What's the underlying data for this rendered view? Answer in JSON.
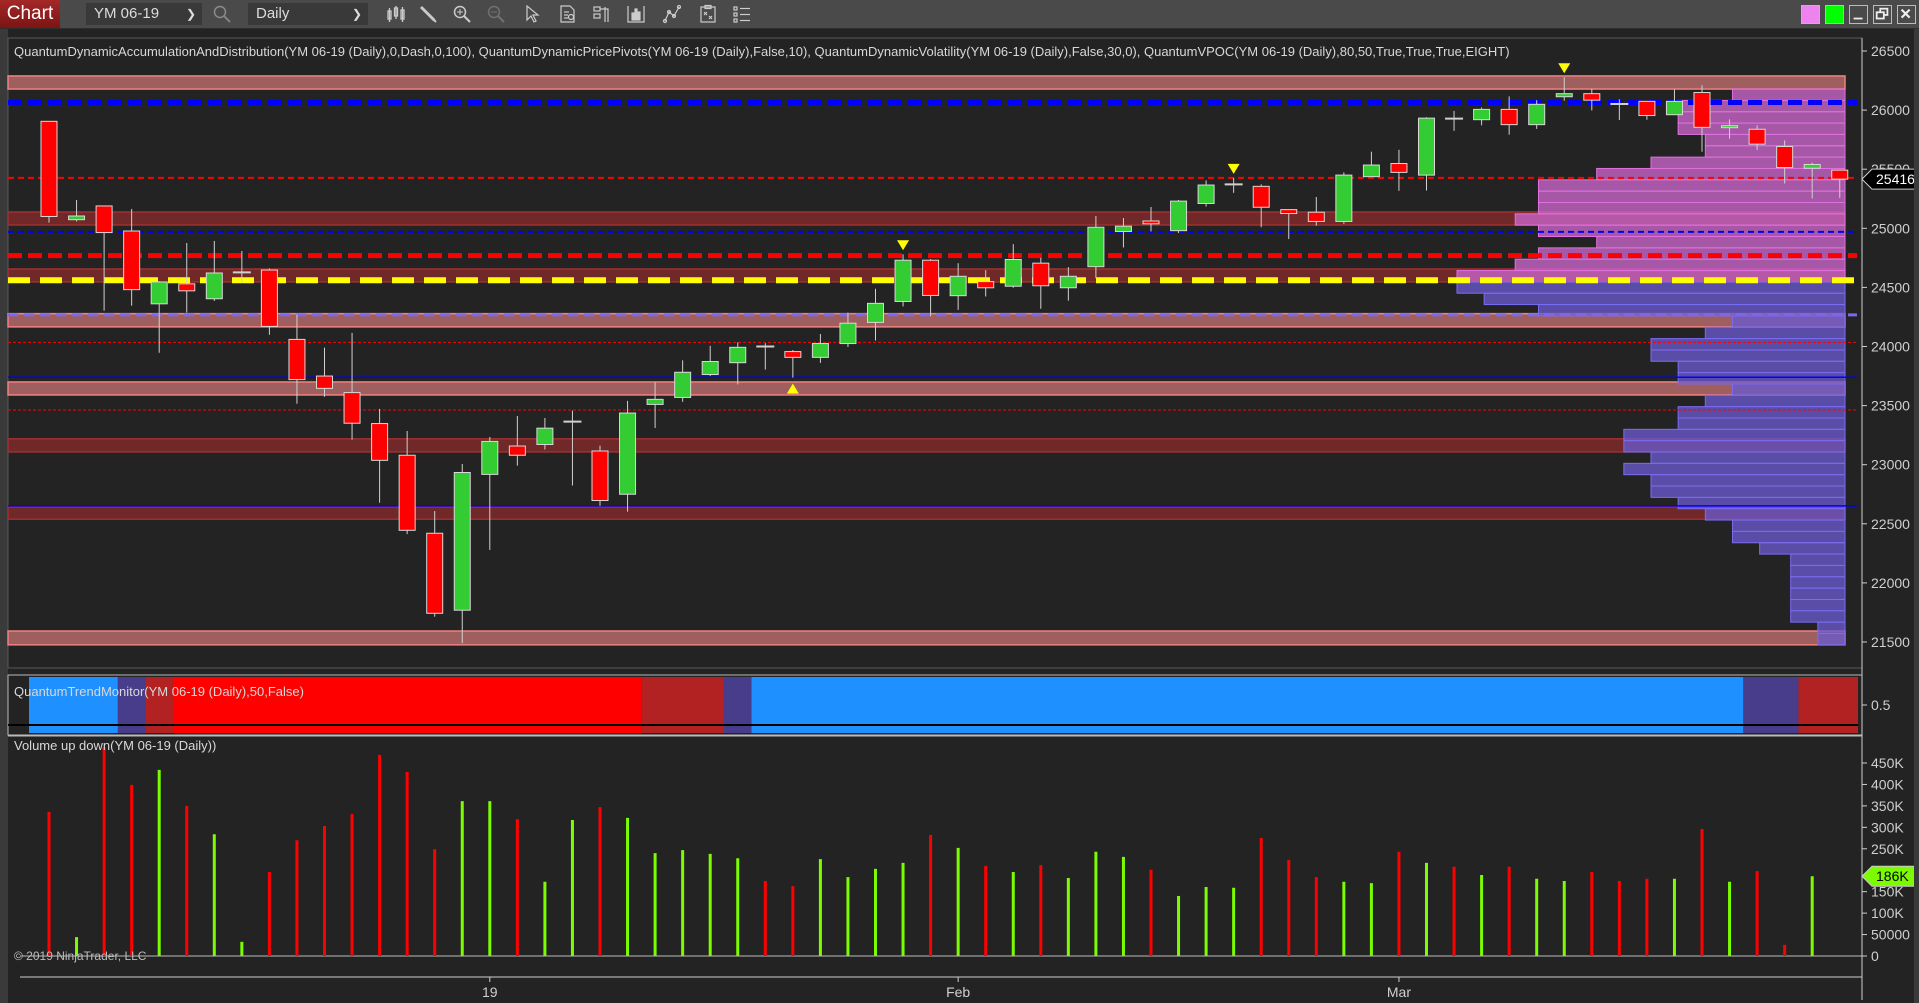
{
  "toolbar": {
    "tab_label": "Chart",
    "instrument": "YM 06-19",
    "timeframe": "Daily",
    "icons": [
      "search-icon",
      "bar-type-icon",
      "drawing-pencil-icon",
      "zoom-in-icon",
      "zoom-out-icon",
      "pointer-icon",
      "data-box-icon",
      "chart-trader-icon",
      "indicators-icon",
      "strategies-icon",
      "templates-icon",
      "properties-list-icon"
    ],
    "window_buttons": [
      "pink-color-swatch",
      "green-color-swatch",
      "minimize-button",
      "restore-button",
      "close-button"
    ],
    "colors": {
      "swatch_pink": "#ee82ee",
      "swatch_green": "#00ff00"
    }
  },
  "price_panel": {
    "indicators_label": "QuantumDynamicAccumulationAndDistribution(YM 06-19 (Daily),0,Dash,0,100), QuantumDynamicPricePivots(YM 06-19 (Daily),False,10), QuantumDynamicVolatility(YM 06-19 (Daily),False,30,0), QuantumVPOC(YM 06-19 (Daily),80,50,True,True,True,EIGHT)",
    "axis_ticks": [
      "26500",
      "26000",
      "25500",
      "25000",
      "24500",
      "24000",
      "23500",
      "23000",
      "22500",
      "22000",
      "21500"
    ],
    "last_price_label": "25416",
    "colors": {
      "up": "#33cc33",
      "down": "#ff0000",
      "wick": "#d0d0d0",
      "bg": "#232323"
    }
  },
  "trend_panel": {
    "label": "QuantumTrendMonitor(YM 06-19 (Daily),50,False)",
    "axis_tick": "0.5",
    "segments": [
      {
        "from_bar": 1,
        "to_bar": 3,
        "state": "bullish",
        "color": "#1e90ff"
      },
      {
        "from_bar": 4,
        "to_bar": 4,
        "state": "neutral",
        "color": "#483d8b"
      },
      {
        "from_bar": 5,
        "to_bar": 5,
        "state": "weak-bearish",
        "color": "#b22222"
      },
      {
        "from_bar": 6,
        "to_bar": 22,
        "state": "bearish",
        "color": "#ff0000"
      },
      {
        "from_bar": 23,
        "to_bar": 25,
        "state": "weak-bearish",
        "color": "#b22222"
      },
      {
        "from_bar": 26,
        "to_bar": 26,
        "state": "neutral",
        "color": "#483d8b"
      },
      {
        "from_bar": 27,
        "to_bar": 62,
        "state": "bullish",
        "color": "#1e90ff"
      },
      {
        "from_bar": 63,
        "to_bar": 64,
        "state": "neutral",
        "color": "#483d8b"
      },
      {
        "from_bar": 65,
        "to_bar": 66,
        "state": "weak-bearish",
        "color": "#b22222"
      }
    ]
  },
  "volume_panel": {
    "label": "Volume up down(YM 06-19 (Daily))",
    "axis_ticks": [
      "450K",
      "400K",
      "350K",
      "300K",
      "250K",
      "150K",
      "100K",
      "50000",
      "0"
    ],
    "last_volume_label": "186K",
    "colors": {
      "up": "#7cfc00",
      "down": "#ff0000"
    }
  },
  "x_axis": {
    "labels": [
      {
        "text": "19",
        "bar": 17
      },
      {
        "text": "Feb",
        "bar": 34
      },
      {
        "text": "Mar",
        "bar": 50
      }
    ]
  },
  "copyright": "© 2019 NinjaTrader, LLC",
  "chart_data": {
    "type": "candlestick",
    "title": "YM 06-19 (Daily)",
    "ylim": [
      21400,
      26600
    ],
    "volume_ylim": [
      0,
      500000
    ],
    "candles": [
      [
        25905,
        25905,
        25048,
        25100
      ],
      [
        25073,
        25240,
        25058,
        25104
      ],
      [
        25189,
        25189,
        24303,
        24964
      ],
      [
        24977,
        25164,
        24345,
        24481
      ],
      [
        24361,
        24553,
        23947,
        24546
      ],
      [
        24530,
        24876,
        24287,
        24471
      ],
      [
        24404,
        24893,
        24385,
        24622
      ],
      [
        24627,
        24808,
        24537,
        24627
      ],
      [
        24647,
        24660,
        24099,
        24170
      ],
      [
        24060,
        24271,
        23516,
        23720
      ],
      [
        23750,
        23990,
        23575,
        23646
      ],
      [
        23610,
        24115,
        23212,
        23351
      ],
      [
        23348,
        23472,
        22678,
        23037
      ],
      [
        23080,
        23285,
        22413,
        22445
      ],
      [
        22420,
        22608,
        21714,
        21743
      ],
      [
        21769,
        23006,
        21490,
        22934
      ],
      [
        22918,
        23235,
        22279,
        23197
      ],
      [
        23158,
        23412,
        22992,
        23080
      ],
      [
        23171,
        23395,
        23129,
        23309
      ],
      [
        23364,
        23458,
        22824,
        23364
      ],
      [
        23116,
        23161,
        22652,
        22697
      ],
      [
        22750,
        23540,
        22603,
        23437
      ],
      [
        23510,
        23698,
        23310,
        23553
      ],
      [
        23569,
        23883,
        23532,
        23782
      ],
      [
        23763,
        24006,
        23750,
        23873
      ],
      [
        23863,
        24035,
        23679,
        23993
      ],
      [
        24000,
        24028,
        23805,
        24000
      ],
      [
        23957,
        23970,
        23737,
        23908
      ],
      [
        23908,
        24106,
        23861,
        24025
      ],
      [
        24025,
        24287,
        23996,
        24197
      ],
      [
        24204,
        24489,
        24051,
        24365
      ],
      [
        24381,
        24780,
        24339,
        24730
      ],
      [
        24730,
        24740,
        24255,
        24432
      ],
      [
        24430,
        24705,
        24310,
        24594
      ],
      [
        24549,
        24646,
        24423,
        24497
      ],
      [
        24510,
        24866,
        24497,
        24736
      ],
      [
        24705,
        24750,
        24319,
        24514
      ],
      [
        24497,
        24672,
        24388,
        24594
      ],
      [
        24675,
        25104,
        24578,
        25009
      ],
      [
        24973,
        25087,
        24838,
        25018
      ],
      [
        25062,
        25180,
        24973,
        25038
      ],
      [
        24980,
        25240,
        24960,
        25230
      ],
      [
        25210,
        25405,
        25184,
        25366
      ],
      [
        25372,
        25427,
        25300,
        25372
      ],
      [
        25355,
        25372,
        25009,
        25178
      ],
      [
        25158,
        25158,
        24909,
        25125
      ],
      [
        25136,
        25265,
        25022,
        25058
      ],
      [
        25058,
        25473,
        25038,
        25450
      ],
      [
        25437,
        25648,
        25437,
        25535
      ],
      [
        25548,
        25664,
        25317,
        25473
      ],
      [
        25450,
        25939,
        25320,
        25932
      ],
      [
        25928,
        25993,
        25825,
        25928
      ],
      [
        25919,
        26022,
        25871,
        26006
      ],
      [
        26006,
        26116,
        25792,
        25877
      ],
      [
        25877,
        26084,
        25841,
        26049
      ],
      [
        26113,
        26278,
        26080,
        26139
      ],
      [
        26139,
        26181,
        25997,
        26084
      ],
      [
        26052,
        26091,
        25916,
        26052
      ],
      [
        26074,
        26074,
        25919,
        25954
      ],
      [
        25961,
        26175,
        25961,
        26074
      ],
      [
        26149,
        26210,
        25648,
        25854
      ],
      [
        25854,
        25922,
        25757,
        25868
      ],
      [
        25838,
        25871,
        25662,
        25712
      ],
      [
        25692,
        25744,
        25379,
        25514
      ],
      [
        25508,
        25556,
        25252,
        25540
      ],
      [
        25492,
        25492,
        25258,
        25416
      ]
    ],
    "candle_fields": [
      "open",
      "high",
      "low",
      "close"
    ],
    "volume": [
      336000,
      44000,
      487000,
      399000,
      434000,
      350000,
      284000,
      33000,
      196000,
      270000,
      303000,
      331000,
      469000,
      429000,
      249000,
      361000,
      361000,
      319000,
      173000,
      317000,
      347000,
      322000,
      240000,
      247000,
      238000,
      228000,
      175000,
      163000,
      226000,
      184000,
      203000,
      217000,
      282000,
      252000,
      210000,
      196000,
      212000,
      182000,
      243000,
      231000,
      201000,
      140000,
      161000,
      159000,
      275000,
      224000,
      184000,
      173000,
      170000,
      243000,
      217000,
      208000,
      189000,
      208000,
      180000,
      175000,
      196000,
      175000,
      180000,
      180000,
      296000,
      173000,
      198000,
      26000,
      186000
    ],
    "volume_direction": [
      "down",
      "up",
      "down",
      "down",
      "up",
      "down",
      "up",
      "up",
      "down",
      "down",
      "down",
      "down",
      "down",
      "down",
      "down",
      "up",
      "up",
      "down",
      "up",
      "up",
      "down",
      "up",
      "up",
      "up",
      "up",
      "up",
      "down",
      "down",
      "up",
      "up",
      "up",
      "up",
      "down",
      "up",
      "down",
      "up",
      "down",
      "up",
      "up",
      "up",
      "down",
      "up",
      "up",
      "up",
      "down",
      "down",
      "down",
      "up",
      "up",
      "down",
      "up",
      "down",
      "up",
      "down",
      "up",
      "up",
      "down",
      "down",
      "down",
      "up",
      "down",
      "up",
      "down",
      "down",
      "up"
    ],
    "signals": [
      {
        "bar": 28,
        "type": "up-arrow",
        "color": "#ffff00"
      },
      {
        "bar": 32,
        "type": "down-arrow",
        "color": "#ffff00"
      },
      {
        "bar": 44,
        "type": "down-arrow",
        "color": "#ffff00"
      },
      {
        "bar": 56,
        "type": "down-arrow",
        "color": "#ffff00"
      }
    ],
    "zones": [
      {
        "top": 26289,
        "bottom": 26178,
        "kind": "resistance-light",
        "color": "#a05f5f"
      },
      {
        "top": 25138,
        "bottom": 25028,
        "kind": "resistance-dark",
        "color": "#702828"
      },
      {
        "top": 24656,
        "bottom": 24546,
        "kind": "resistance-dark",
        "color": "#702828"
      },
      {
        "top": 24278,
        "bottom": 24166,
        "kind": "support-light",
        "color": "#a05f5f"
      },
      {
        "top": 23700,
        "bottom": 23590,
        "kind": "support-light",
        "color": "#a05f5f"
      },
      {
        "top": 23219,
        "bottom": 23108,
        "kind": "support-dark",
        "color": "#702828"
      },
      {
        "top": 22642,
        "bottom": 22539,
        "kind": "support-dark",
        "color": "#702828"
      },
      {
        "top": 21593,
        "bottom": 21476,
        "kind": "support-light",
        "color": "#a05f5f"
      }
    ],
    "levels": [
      {
        "price": 26064,
        "color": "#0000ff",
        "style": "dash-thick"
      },
      {
        "price": 25427,
        "color": "#ff0000",
        "style": "dash-thin"
      },
      {
        "price": 24970,
        "color": "#0000ff",
        "style": "dash-thin"
      },
      {
        "price": 24769,
        "color": "#ff0000",
        "style": "dash-thick"
      },
      {
        "price": 24560,
        "color": "#ffff00",
        "style": "dash-poc"
      },
      {
        "price": 24268,
        "color": "#7b68ee",
        "style": "dash-medium"
      },
      {
        "price": 24035,
        "color": "#ff0000",
        "style": "dot"
      },
      {
        "price": 23740,
        "color": "#0000ff",
        "style": "solid-thin"
      },
      {
        "price": 23463,
        "color": "#ff0000",
        "style": "dot"
      },
      {
        "price": 22652,
        "color": "#0000ff",
        "style": "solid-thin"
      }
    ],
    "volume_profile": {
      "price_top": 26178,
      "price_bottom": 21476,
      "poc_row": 17,
      "upper_color": "#cc66cc",
      "lower_color": "#6a5acd",
      "rows": [
        0.29,
        0.43,
        0.43,
        0.43,
        0.36,
        0.36,
        0.5,
        0.64,
        0.79,
        0.79,
        0.79,
        0.85,
        0.79,
        0.64,
        0.79,
        0.85,
        1.0,
        1.0,
        0.93,
        0.79,
        0.29,
        0.36,
        0.5,
        0.5,
        0.43,
        0.43,
        0.29,
        0.36,
        0.43,
        0.43,
        0.57,
        0.57,
        0.5,
        0.57,
        0.5,
        0.5,
        0.43,
        0.36,
        0.29,
        0.29,
        0.22,
        0.14,
        0.14,
        0.14,
        0.14,
        0.14,
        0.14,
        0.07,
        0.07
      ]
    }
  }
}
